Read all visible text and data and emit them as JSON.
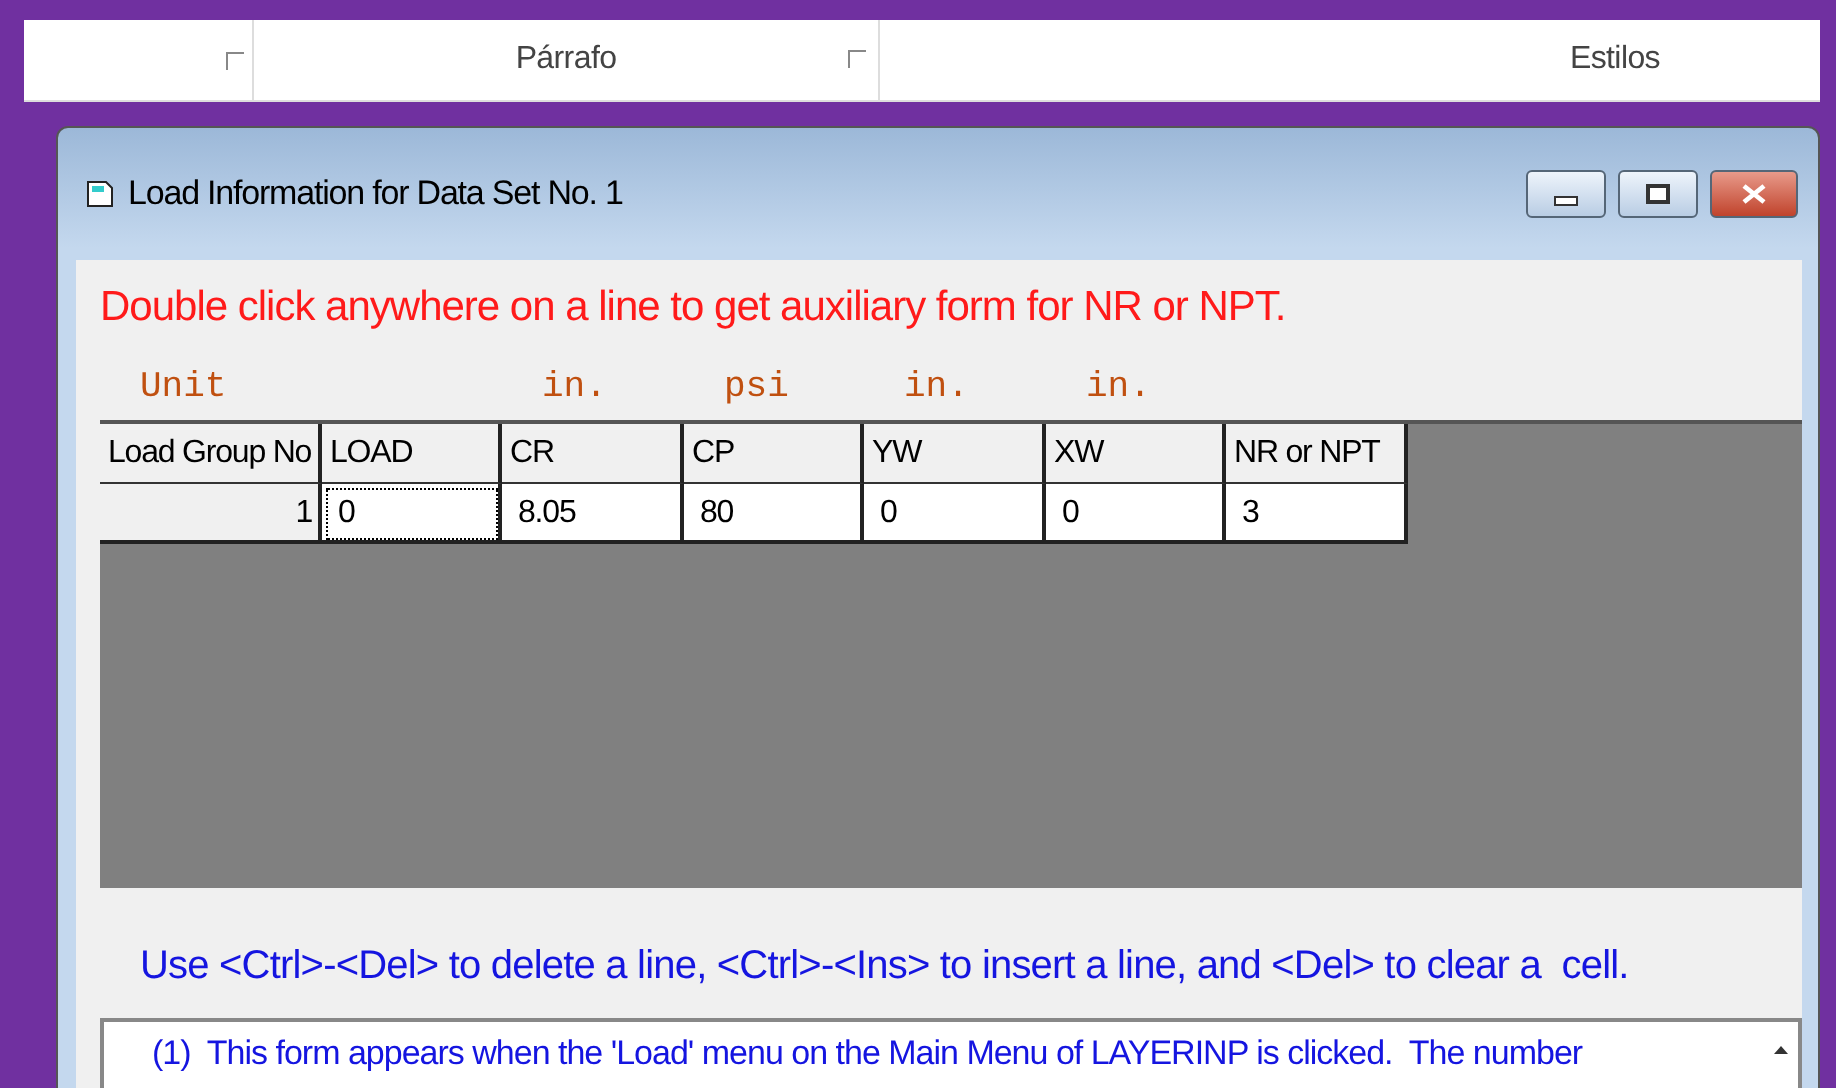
{
  "ribbon": {
    "groups": [
      {
        "label": "Párrafo"
      },
      {
        "label": "Estilos"
      }
    ]
  },
  "window": {
    "title": "Load Information for Data Set No. 1"
  },
  "instruction": "Double click anywhere on a line to get auxiliary form for NR or NPT.",
  "table": {
    "columns": [
      {
        "label": "Load Group No",
        "unit": "Unit"
      },
      {
        "label": "LOAD"
      },
      {
        "label": "CR",
        "unit": "in."
      },
      {
        "label": "CP",
        "unit": "psi"
      },
      {
        "label": "YW",
        "unit": "in."
      },
      {
        "label": "XW",
        "unit": "in."
      },
      {
        "label": "NR or NPT"
      }
    ],
    "rows": [
      {
        "cells": [
          {
            "text": "1",
            "focused": false
          },
          {
            "text": "0",
            "focused": true
          },
          {
            "text": "8.05",
            "focused": false
          },
          {
            "text": "80",
            "focused": false
          },
          {
            "text": "0",
            "focused": false
          },
          {
            "text": "0",
            "focused": false
          },
          {
            "text": "3",
            "focused": false
          }
        ]
      }
    ]
  },
  "hint": "Use <Ctrl>-<Del> to delete a line, <Ctrl>-<Ins> to insert a line, and <Del> to clear a  cell.",
  "notes": "(1)  This form appears when the 'Load' menu on the Main Menu of LAYERINP is clicked.  The number"
}
